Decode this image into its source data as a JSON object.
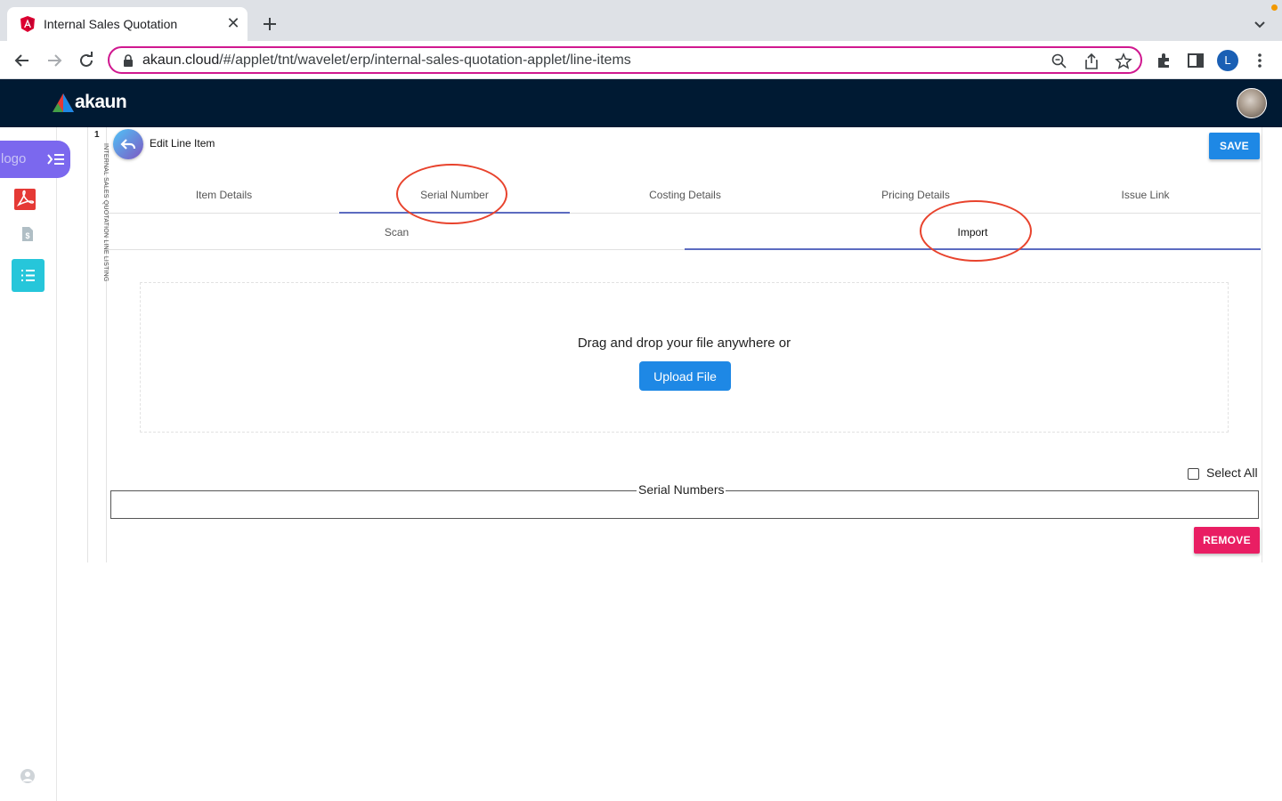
{
  "browser": {
    "tab_title": "Internal Sales Quotation",
    "url_host": "akaun.cloud",
    "url_path": "/#/applet/tnt/wavelet/erp/internal-sales-quotation-applet/line-items",
    "profile_initial": "L"
  },
  "app": {
    "brand": "akaun"
  },
  "rail": {
    "logo_alt": "logo"
  },
  "listing": {
    "number": "1",
    "label": "INTERNAL SALES QUOTATION LINE LISTING"
  },
  "panel": {
    "title": "Edit Line Item",
    "save_label": "SAVE",
    "tabs": [
      {
        "label": "Item Details"
      },
      {
        "label": "Serial Number"
      },
      {
        "label": "Costing Details"
      },
      {
        "label": "Pricing Details"
      },
      {
        "label": "Issue Link"
      }
    ],
    "active_tab": "Serial Number",
    "subtabs": [
      {
        "label": "Scan"
      },
      {
        "label": "Import"
      }
    ],
    "active_subtab": "Import",
    "dropzone_text": "Drag and drop your file anywhere or",
    "upload_label": "Upload File",
    "select_all_label": "Select All",
    "serial_numbers_label": "Serial Numbers",
    "remove_label": "REMOVE"
  },
  "colors": {
    "appbar": "#001a33",
    "accent": "#1e88e5",
    "danger": "#e91e63",
    "annotation": "#e8432d",
    "tab_indicator": "#5c6bc0"
  }
}
